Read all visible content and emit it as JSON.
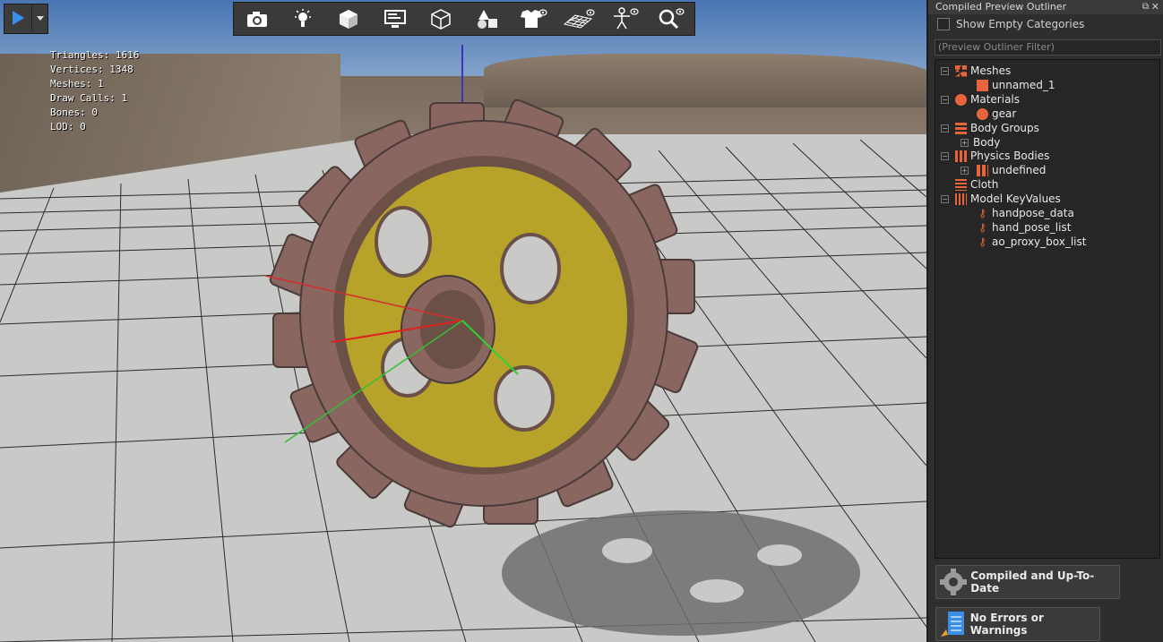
{
  "viewport": {
    "stats": [
      "Triangles: 1616",
      "Vertices: 1348",
      "Meshes: 1",
      "Draw Calls: 1",
      "Bones: 0",
      "LOD: 0"
    ],
    "toolbar_icons": [
      "camera-icon",
      "light-icon",
      "cube-icon",
      "monitor-icon",
      "wireframe-cube-icon",
      "shapes-icon",
      "tshirt-visibility-icon",
      "grid-visibility-icon",
      "skeleton-visibility-icon",
      "zoom-visibility-icon"
    ]
  },
  "panel": {
    "title": "Compiled Preview Outliner",
    "show_empty_label": "Show Empty Categories",
    "filter_placeholder": "(Preview Outliner Filter)",
    "tree": {
      "meshes": "Meshes",
      "mesh_item": "unnamed_1",
      "materials": "Materials",
      "material_item": "gear",
      "body_groups": "Body Groups",
      "body_item": "Body",
      "physics_bodies": "Physics Bodies",
      "physics_item": "undefined",
      "cloth": "Cloth",
      "model_keyvalues": "Model KeyValues",
      "kv_items": [
        "handpose_data",
        "hand_pose_list",
        "ao_proxy_box_list"
      ]
    },
    "status_compiled": "Compiled and Up-To-Date",
    "status_errors": "No Errors or Warnings"
  },
  "colors": {
    "accent_orange": "#e8643c",
    "play_blue": "#3a8ee6",
    "gear_yellow": "#b8a32a",
    "gear_rust": "#8a6660"
  }
}
